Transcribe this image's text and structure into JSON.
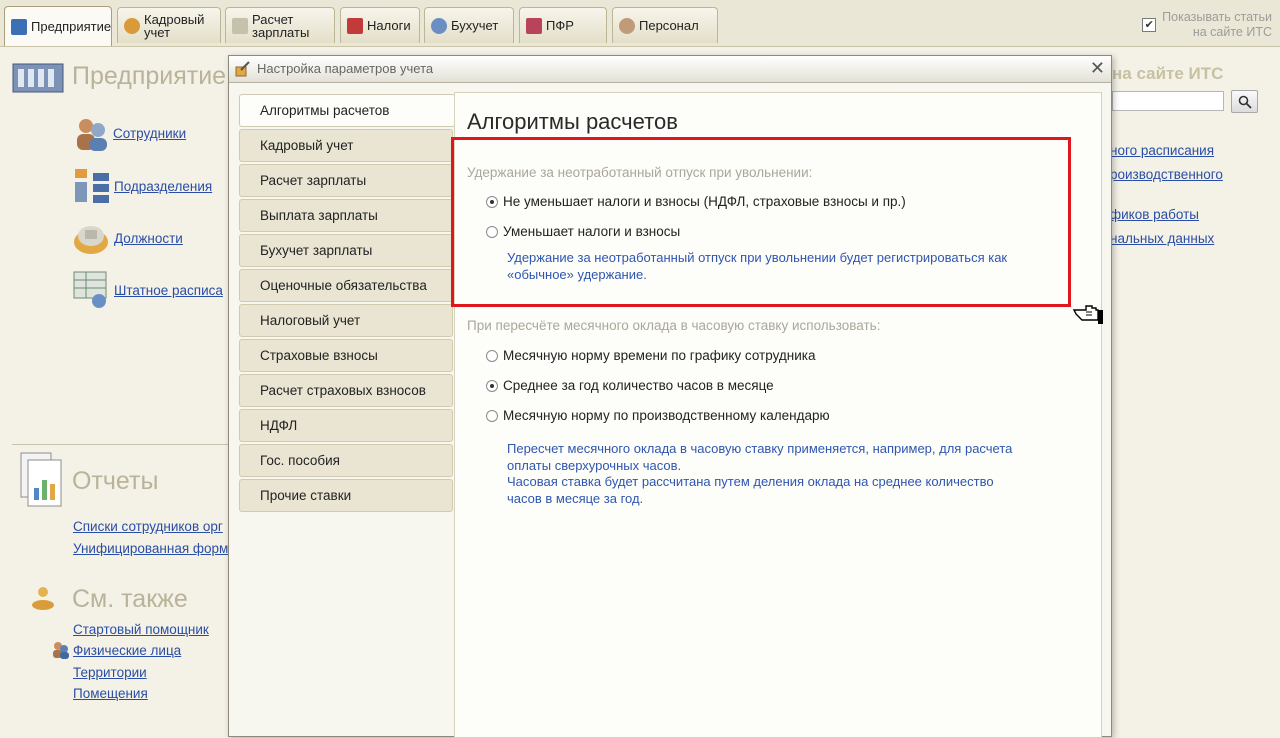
{
  "tabs": [
    {
      "label": "Предприятие",
      "active": true
    },
    {
      "label": "Кадровый\nучет"
    },
    {
      "label": "Расчет\nзарплаты"
    },
    {
      "label": "Налоги"
    },
    {
      "label": "Бухучет"
    },
    {
      "label": "ПФР"
    },
    {
      "label": "Персонал"
    }
  ],
  "its_toggle": {
    "label": "Показывать статьи\nна сайте ИТС",
    "checked": "✔"
  },
  "left_panel": {
    "section1": {
      "title": "Предприятие",
      "links": [
        "Сотрудники",
        "Подразделения",
        "Должности",
        "Штатное расписа"
      ]
    },
    "section2": {
      "title": "Отчеты",
      "links": [
        "Списки сотрудников орг",
        "Унифицированная форм"
      ]
    },
    "section3": {
      "title": "См. также",
      "links": [
        "Стартовый помощник",
        "Физические лица",
        "Территории",
        "Помещения"
      ]
    }
  },
  "right_panel": {
    "title": "на сайте ИТС",
    "links": [
      "ного расписания",
      "роизводственного",
      "фиков работы",
      "нальных данных"
    ]
  },
  "dialog": {
    "title": "Настройка параметров учета",
    "close": "✕",
    "nav": [
      "Алгоритмы расчетов",
      "Кадровый учет",
      "Расчет зарплаты",
      "Выплата зарплаты",
      "Бухучет зарплаты",
      "Оценочные обязательства",
      "Налоговый учет",
      "Страховые взносы",
      "Расчет страховых взносов",
      "НДФЛ",
      "Гос. пособия",
      "Прочие ставки"
    ],
    "active_nav": 0,
    "content": {
      "title": "Алгоритмы расчетов",
      "group1": {
        "label": "Удержание за неотработанный отпуск при увольнении:",
        "options": [
          "Не уменьшает налоги и взносы (НДФЛ, страховые взносы и пр.)",
          "Уменьшает налоги и взносы"
        ],
        "selected": 0,
        "note": "Удержание за неотработанный отпуск при увольнении будет регистрироваться как\n«обычное» удержание."
      },
      "group2": {
        "label": "При пересчёте месячного оклада в часовую ставку использовать:",
        "options": [
          "Месячную норму времени по графику сотрудника",
          "Среднее за год количество часов в месяце",
          "Месячную норму по производственному календарю"
        ],
        "selected": 1,
        "note": "Пересчет месячного оклада в часовую ставку применяется, например, для расчета\nоплаты сверхурочных часов.\nЧасовая ставка будет рассчитана путем деления оклада на среднее количество\nчасов в месяце за год."
      }
    }
  },
  "colors": {
    "accent": "#e0161c",
    "link": "#2a4ea6",
    "note": "#2f56b0"
  }
}
